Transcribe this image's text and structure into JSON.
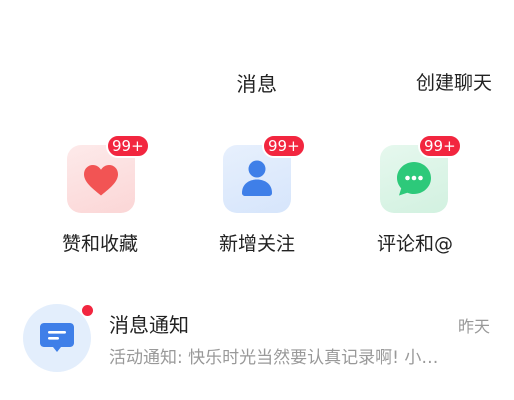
{
  "header": {
    "title": "消息",
    "create_chat_label": "创建聊天"
  },
  "quick_entries": [
    {
      "label": "赞和收藏",
      "badge": "99+",
      "icon": "heart-icon"
    },
    {
      "label": "新增关注",
      "badge": "99+",
      "icon": "person-icon"
    },
    {
      "label": "评论和@",
      "badge": "99+",
      "icon": "chat-bubble-icon"
    }
  ],
  "messages": [
    {
      "title": "消息通知",
      "time": "昨天",
      "preview": "活动通知: 快乐时光当然要认真记录啊! 小…",
      "icon": "notification-icon",
      "unread": true
    }
  ],
  "colors": {
    "badge": "#f2263f",
    "heart": "#f25454",
    "heart_bg": "#fde3e3",
    "person": "#3f7fe8",
    "person_bg": "#e1ecfc",
    "chat": "#2dc97a",
    "chat_bg": "#ddf5e8",
    "notify": "#3f7fe8",
    "notify_bg": "#e3eefc",
    "secondary_text": "#999999"
  }
}
